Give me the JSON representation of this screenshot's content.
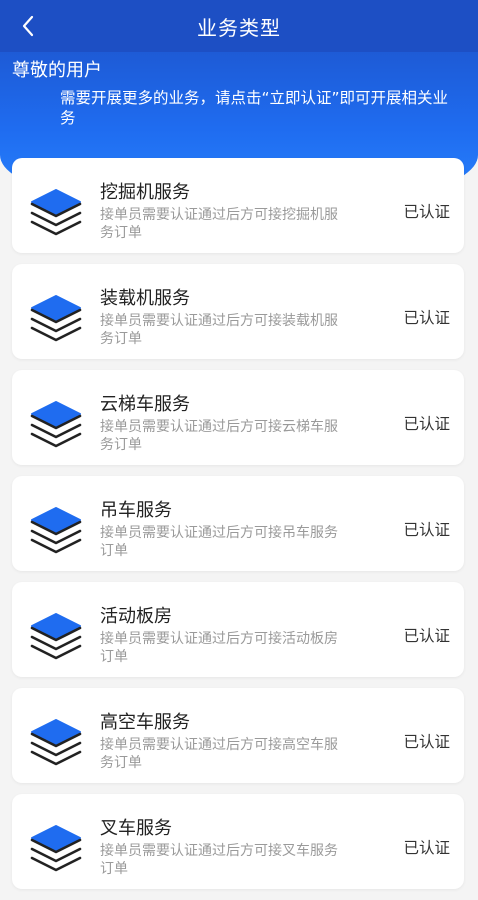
{
  "header": {
    "title": "业务类型"
  },
  "banner": {
    "greeting": "尊敬的用户",
    "notice": "需要开展更多的业务，请点击“立即认证”即可开展相关业务"
  },
  "services": [
    {
      "title": "挖掘机服务",
      "desc": "接单员需要认证通过后方可接挖掘机服务订单",
      "status": "已认证"
    },
    {
      "title": "装载机服务",
      "desc": "接单员需要认证通过后方可接装载机服务订单",
      "status": "已认证"
    },
    {
      "title": "云梯车服务",
      "desc": "接单员需要认证通过后方可接云梯车服务订单",
      "status": "已认证"
    },
    {
      "title": "吊车服务",
      "desc": "接单员需要认证通过后方可接吊车服务订单",
      "status": "已认证"
    },
    {
      "title": "活动板房",
      "desc": "接单员需要认证通过后方可接活动板房订单",
      "status": "已认证"
    },
    {
      "title": "高空车服务",
      "desc": "接单员需要认证通过后方可接高空车服务订单",
      "status": "已认证"
    },
    {
      "title": "叉车服务",
      "desc": "接单员需要认证通过后方可接叉车服务订单",
      "status": "已认证"
    }
  ],
  "colors": {
    "primary": "#1d4fc4",
    "icon_blue": "#1f6cf0",
    "icon_line": "#222222"
  },
  "icons": {
    "back": "chevron-left-icon",
    "service": "layers-icon"
  }
}
